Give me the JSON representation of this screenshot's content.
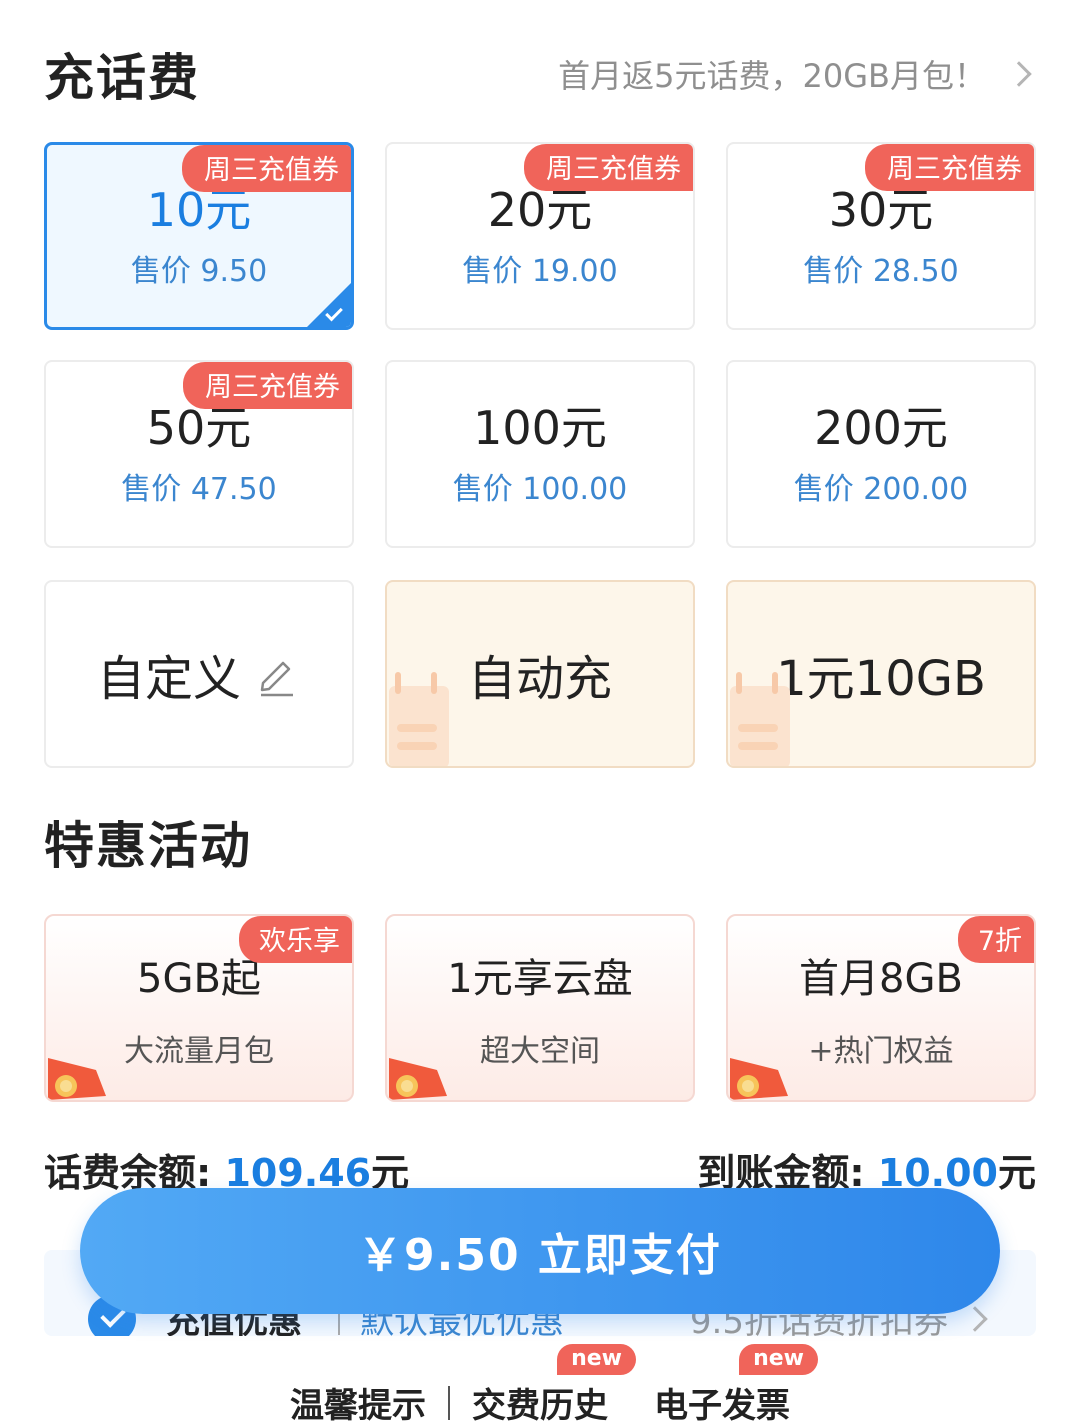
{
  "header": {
    "title": "充话费",
    "promo": "首月返5元话费，20GB月包！"
  },
  "recharge_options": [
    {
      "amount": "10元",
      "price": "售价 9.50",
      "tag": "周三充值券",
      "selected": true
    },
    {
      "amount": "20元",
      "price": "售价 19.00",
      "tag": "周三充值券"
    },
    {
      "amount": "30元",
      "price": "售价 28.50",
      "tag": "周三充值券"
    },
    {
      "amount": "50元",
      "price": "售价 47.50",
      "tag": "周三充值券"
    },
    {
      "amount": "100元",
      "price": "售价 100.00"
    },
    {
      "amount": "200元",
      "price": "售价 200.00"
    }
  ],
  "extra_options": {
    "custom": "自定义",
    "auto": "自动充",
    "data_deal": "1元10GB"
  },
  "activities": {
    "title": "特惠活动",
    "items": [
      {
        "title": "5GB起",
        "subtitle": "大流量月包",
        "tag": "欢乐享"
      },
      {
        "title": "1元享云盘",
        "subtitle": "超大空间"
      },
      {
        "title": "首月8GB",
        "subtitle": "+热门权益",
        "tag": "7折"
      }
    ]
  },
  "summary": {
    "balance_label": "话费余额:",
    "balance_value": "109.46",
    "balance_unit": "元",
    "arrival_label": "到账金额:",
    "arrival_value": "10.00",
    "arrival_unit": "元"
  },
  "discount": {
    "label": "充值优惠",
    "default": "默认最优优惠",
    "coupon": "9.5折话费折扣券"
  },
  "pay_button": "￥9.50 立即支付",
  "bottom_links": {
    "tips": "温馨提示",
    "history": "交费历史",
    "invoice": "电子发票",
    "new_badge": "new"
  },
  "colors": {
    "accent": "#2a8ae8",
    "tag_red": "#f0645a",
    "price_blue": "#3b86cf"
  }
}
